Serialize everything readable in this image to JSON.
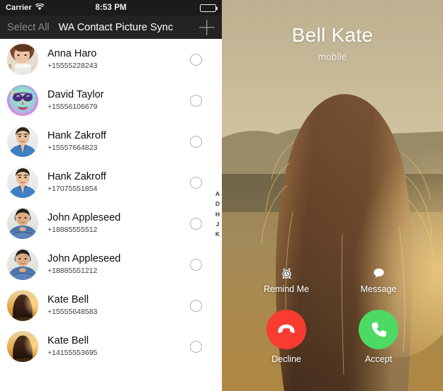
{
  "left_pane": {
    "status_bar": {
      "carrier": "Carrier",
      "wifi_icon": "wifi-icon",
      "time": "8:53 PM",
      "battery_icon": "battery-icon"
    },
    "nav_bar": {
      "select_all_label": "Select All",
      "title": "WA Contact Picture Sync",
      "add_icon": "plus-icon"
    },
    "contacts": [
      {
        "name": "Anna Haro",
        "phone": "+15555228243",
        "avatar": "woman-with-cup",
        "selected": false
      },
      {
        "name": "David Taylor",
        "phone": "+15556106679",
        "avatar": "colorful-sunglasses",
        "selected": false
      },
      {
        "name": "Hank Zakroff",
        "phone": "+15557664823",
        "avatar": "man-blue-shirt",
        "selected": false
      },
      {
        "name": "Hank Zakroff",
        "phone": "+17075551854",
        "avatar": "man-blue-shirt",
        "selected": false
      },
      {
        "name": "John Appleseed",
        "phone": "+18885555512",
        "avatar": "man-arms-crossed",
        "selected": false
      },
      {
        "name": "John Appleseed",
        "phone": "+18885551212",
        "avatar": "man-arms-crossed",
        "selected": false
      },
      {
        "name": "Kate Bell",
        "phone": "+15555648583",
        "avatar": "woman-sunset-hair",
        "selected": false
      },
      {
        "name": "Kate Bell",
        "phone": "+14155553695",
        "avatar": "woman-sunset-hair",
        "selected": false
      }
    ],
    "alphabet_index": [
      "A",
      "D",
      "H",
      "J",
      "K"
    ]
  },
  "right_pane": {
    "caller_name": "Bell Kate",
    "caller_label": "mobile",
    "actions": {
      "remind_me": {
        "label": "Remind Me",
        "icon": "alarm-clock-icon"
      },
      "message": {
        "label": "Message",
        "icon": "speech-bubble-icon"
      },
      "decline": {
        "label": "Decline",
        "icon": "phone-down-icon",
        "color": "#F93B30"
      },
      "accept": {
        "label": "Accept",
        "icon": "phone-icon",
        "color": "#4CD964"
      }
    }
  },
  "colors": {
    "status_bar_bg": "#1b1b1b",
    "nav_bar_bg": "#232323",
    "nav_title": "#ffffff",
    "nav_select_all": "#8b8b8b",
    "list_bg": "#ffffff",
    "contact_name": "#0d0d0d",
    "contact_phone": "#3d3d3d",
    "checkbox_border": "#b3b3b3",
    "decline_red": "#F93B30",
    "accept_green": "#4CD964"
  }
}
